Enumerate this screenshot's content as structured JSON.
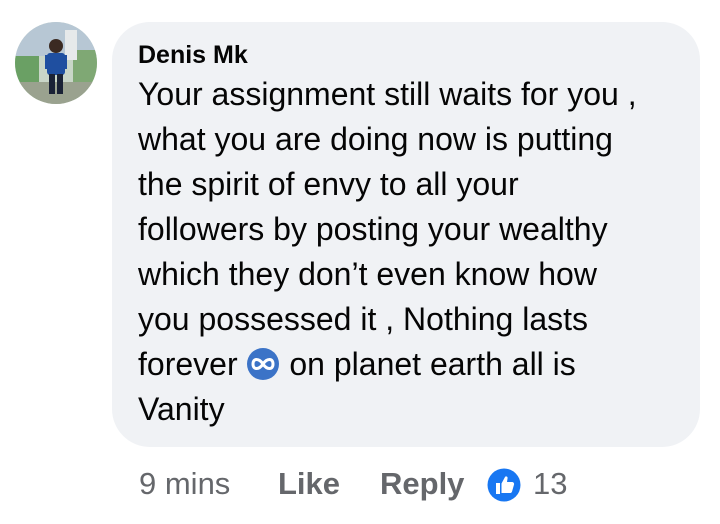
{
  "comment": {
    "author": "Denis Mk",
    "lines": [
      "Your assignment still waits for you ,",
      "what you are doing now is putting",
      "the spirit of envy to all your",
      "followers by posting your wealthy",
      "which they don’t even know how",
      "you possessed it , Nothing lasts"
    ],
    "line7_before": "forever",
    "line7_after": "on planet earth all is",
    "line8": "Vanity",
    "emoji": "infinity-emoji"
  },
  "actions": {
    "time": "9 mins",
    "like_label": "Like",
    "reply_label": "Reply",
    "reaction_icon": "thumbs-up-icon",
    "reaction_count": "13"
  },
  "colors": {
    "bubble": "#f0f2f5",
    "text": "#050505",
    "secondary_text": "#65676b",
    "like_blue": "#1877f2",
    "emoji_blue": "#3b73c7"
  }
}
